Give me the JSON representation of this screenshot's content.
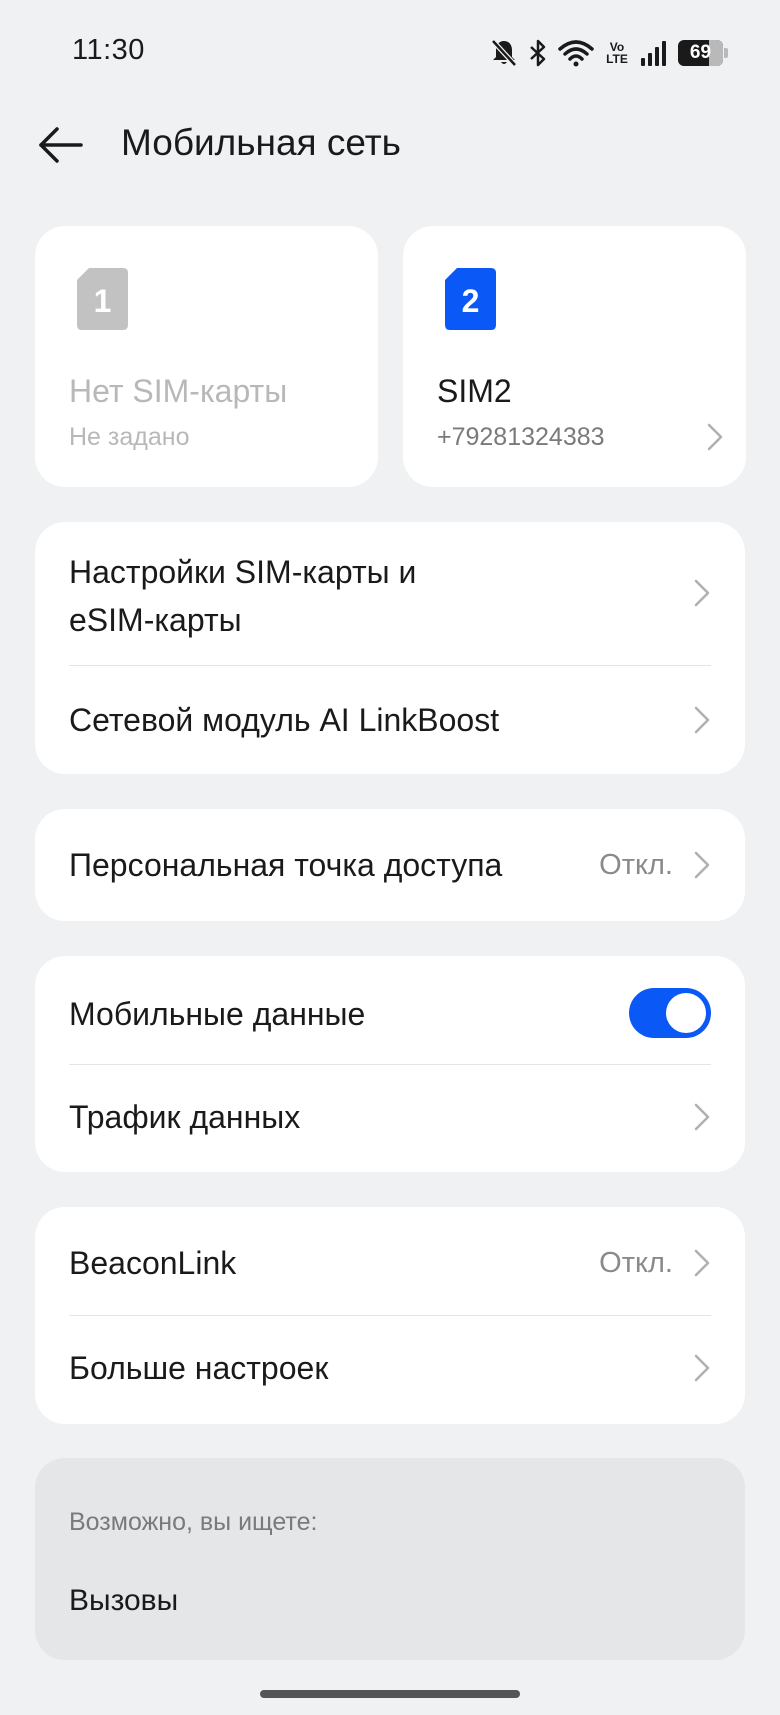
{
  "status_bar": {
    "time": "11:30",
    "volte_top": "Vo",
    "volte_bottom": "LTE",
    "battery_percent": "69",
    "battery_level": 0.69
  },
  "header": {
    "title": "Мобильная сеть"
  },
  "sim_cards": [
    {
      "number": "1",
      "name": "Нет SIM-карты",
      "detail": "Не задано",
      "color": "#c2c2c2"
    },
    {
      "number": "2",
      "name": "SIM2",
      "detail": "+79281324383",
      "color": "#0a59f7"
    }
  ],
  "group1": {
    "sim_settings_line1": "Настройки SIM-карты и",
    "sim_settings_line2": "eSIM-карты",
    "linkboost": "Сетевой модуль AI LinkBoost"
  },
  "group2": {
    "hotspot": "Персональная точка доступа",
    "hotspot_value": "Откл."
  },
  "group3": {
    "mobile_data": "Мобильные данные",
    "mobile_data_on": true,
    "data_traffic": "Трафик данных"
  },
  "group4": {
    "beaconlink": "BeaconLink",
    "beaconlink_value": "Откл.",
    "more_settings": "Больше настроек"
  },
  "suggestions": {
    "title": "Возможно, вы ищете:",
    "items": [
      "Вызовы"
    ]
  },
  "colors": {
    "accent": "#0a59f7",
    "background": "#f0f1f3"
  }
}
